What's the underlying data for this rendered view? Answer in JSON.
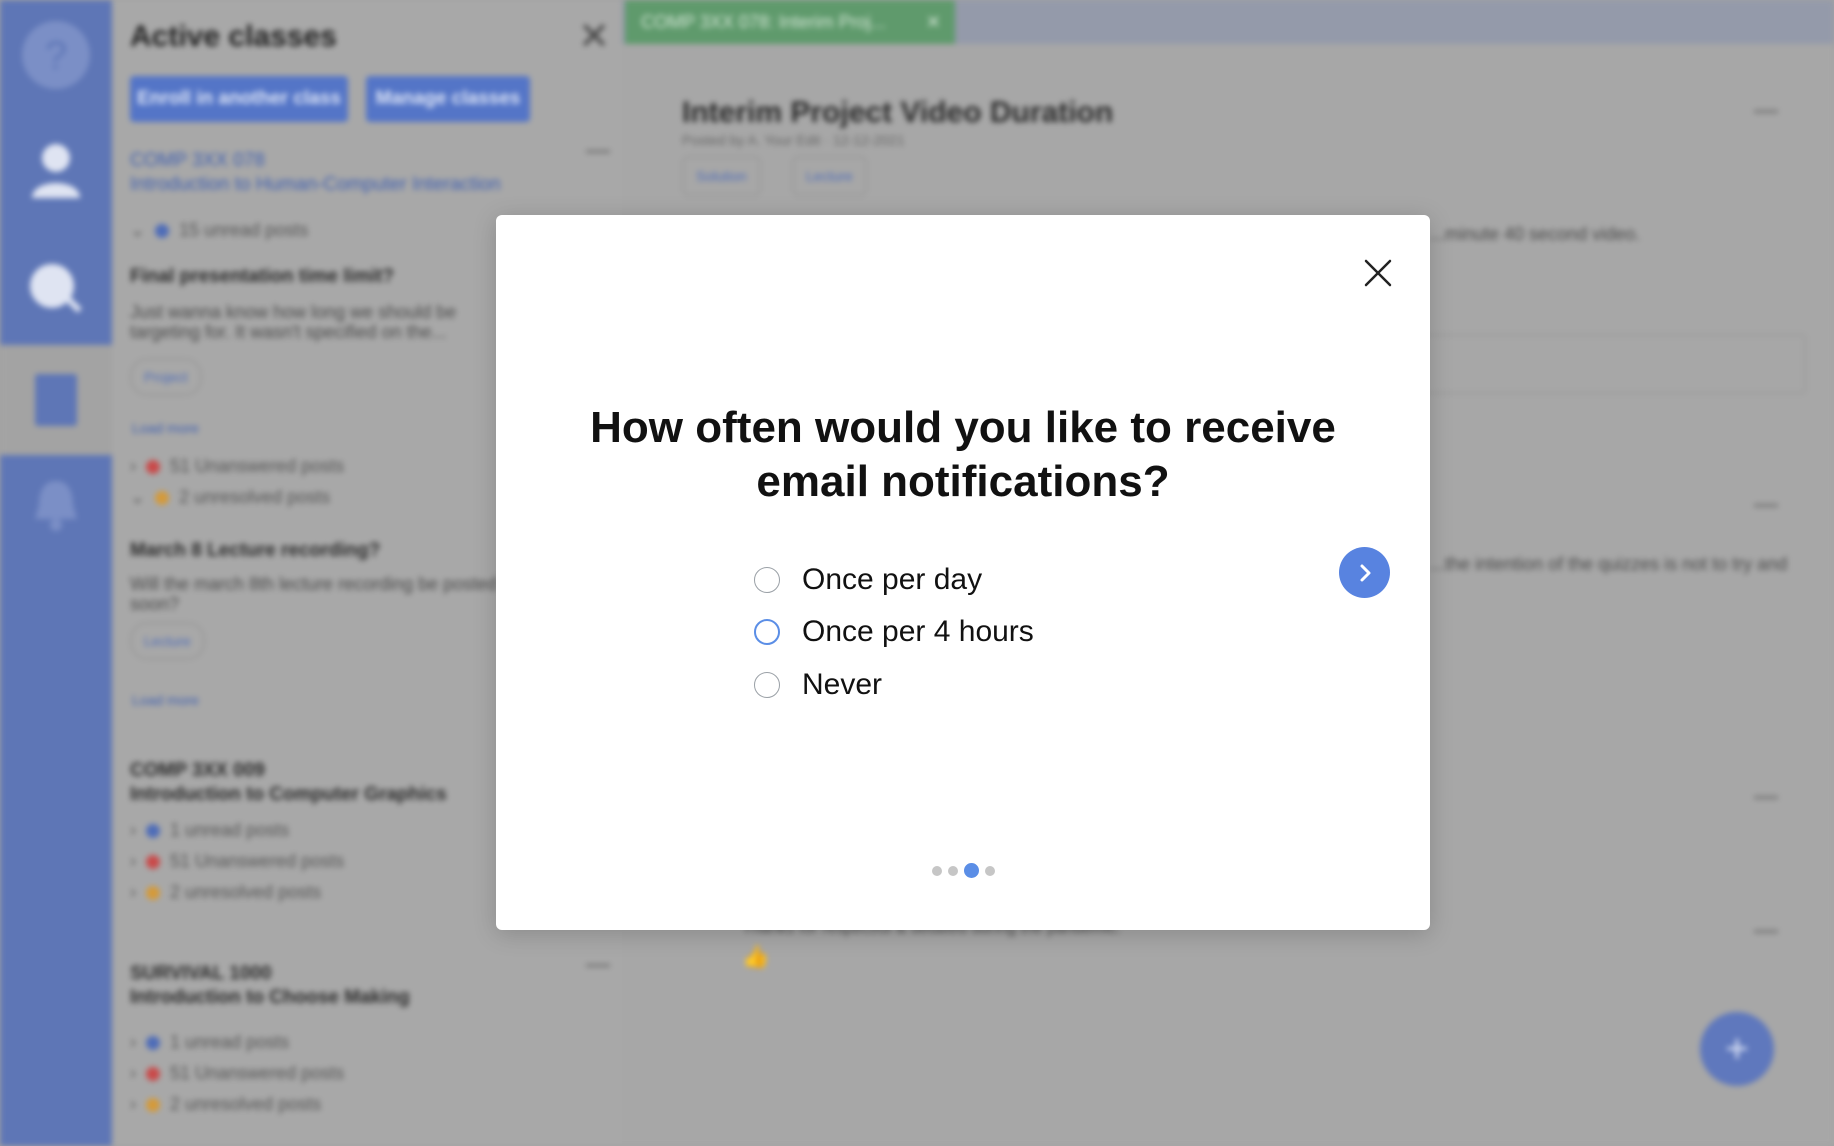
{
  "modal": {
    "question": "How often would you like to receive\nemail notifications?",
    "options": [
      {
        "label": "Once per day",
        "selected": false
      },
      {
        "label": "Once per 4 hours",
        "selected": false,
        "focused": true
      },
      {
        "label": "Never",
        "selected": false
      }
    ],
    "pager": {
      "total": 4,
      "current": 3
    },
    "icons": {
      "close": "close-icon",
      "next": "chevron-right-icon"
    },
    "accent_color": "#5883e0"
  },
  "sidebar": {
    "title": "Active classes",
    "buttons": [
      "Enroll in another class",
      "Manage classes"
    ],
    "classes": [
      {
        "code": "COMP 3XX 078",
        "name": "Introduction to Human-Computer Interaction",
        "stats": [
          "15 unread posts",
          "51 Unanswered posts",
          "2 unresolved posts"
        ],
        "posts": [
          {
            "title": "Final presentation time limit?",
            "body": "Just wanna know how long we should be targeting for. It wasn't specified on the...",
            "tag": "Project"
          },
          {
            "title": "March 8 Lecture recording?",
            "body": "Will the march 8th lecture recording be posted soon?",
            "tag": "Lecture"
          }
        ],
        "load_more": "Load more"
      },
      {
        "code": "COMP 3XX 009",
        "name": "Introduction to Computer Graphics",
        "stats": [
          "1 unread posts",
          "51 Unanswered posts",
          "2 unresolved posts"
        ]
      },
      {
        "code": "SURVIVAL 1000",
        "name": "Introduction to Choose Making",
        "stats": [
          "1 unread posts",
          "51 Unanswered posts",
          "2 unresolved posts"
        ]
      }
    ]
  },
  "tab": {
    "label": "COMP 3XX 078: Interim Proj..."
  },
  "main": {
    "title": "Interim Project Video Duration",
    "meta": "Posted by A. Your Edit  ·  12-12-2021",
    "chips": [
      "Solution",
      "Lecture"
    ],
    "text_snippet": "...minute 40 second video.",
    "text_snippet2": "...the intention of the quizzes is not to try and",
    "text_snippet3": "Thanks for respectful & detailed during the pandemic."
  },
  "colors": {
    "iconbar": "#5e76b6",
    "sidebar_button": "#5475c7",
    "tab": "#5f9a6c",
    "unread": "#4e6cb8",
    "unanswered": "#c94a4a",
    "unresolved": "#d49a3a"
  }
}
